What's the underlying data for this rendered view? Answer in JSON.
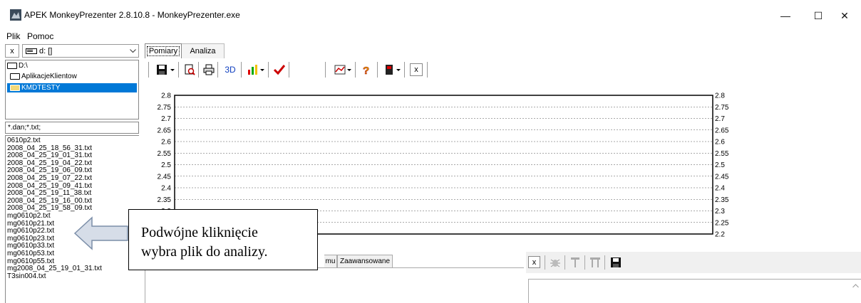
{
  "window": {
    "title": "APEK MonkeyPrezenter 2.8.10.8 - MonkeyPrezenter.exe",
    "minimize": "—",
    "maximize": "☐",
    "close": "✕"
  },
  "menu": [
    "Plik",
    "Pomoc"
  ],
  "drive": {
    "close_label": "x",
    "selected": "d: []"
  },
  "tree": [
    "D:\\",
    "AplikacjeKlientow",
    "KMDTESTY"
  ],
  "filter": "*.dan;*.txt;",
  "files": [
    "0610p2.txt",
    "2008_04_25_18_56_31.txt",
    "2008_04_25_19_01_31.txt",
    "2008_04_25_19_04_22.txt",
    "2008_04_25_19_06_09.txt",
    "2008_04_25_19_07_22.txt",
    "2008_04_25_19_09_41.txt",
    "2008_04_25_19_11_38.txt",
    "2008_04_25_19_16_00.txt",
    "2008_04_25_19_58_09.txt",
    "mg0610p2.txt",
    "mg0610p21.txt",
    "mg0610p22.txt",
    "mg0610p23.txt",
    "mg0610p33.txt",
    "mg0610p53.txt",
    "mg0610p55.txt",
    "mg2008_04_25_19_01_31.txt",
    "T3sin004.txt"
  ],
  "tabs": [
    "Pomiary",
    "Analiza"
  ],
  "toolbar": {
    "view3d": "3D",
    "close_label": "x"
  },
  "bottom": {
    "tabs": [
      "mu",
      "Zaawansowane"
    ],
    "right_close": "x"
  },
  "callout": {
    "line1": "Podwójne kliknięcie",
    "line2": "wybra plik do analizy."
  },
  "chart_data": {
    "type": "line",
    "yticks_left": [
      "2.8",
      "2.75",
      "2.7",
      "2.65",
      "2.6",
      "2.55",
      "2.5",
      "2.45",
      "2.4",
      "2.35",
      "2.3"
    ],
    "yticks_right": [
      "2.8",
      "2.75",
      "2.7",
      "2.65",
      "2.6",
      "2.55",
      "2.5",
      "2.45",
      "2.4",
      "2.35",
      "2.3",
      "2.25",
      "2.2"
    ],
    "ylim": [
      2.2,
      2.8
    ],
    "grid": true,
    "series": []
  },
  "colors": {
    "selection": "#0078d7",
    "accent_red": "#cc0000",
    "accent_yellow": "#f2c200"
  }
}
